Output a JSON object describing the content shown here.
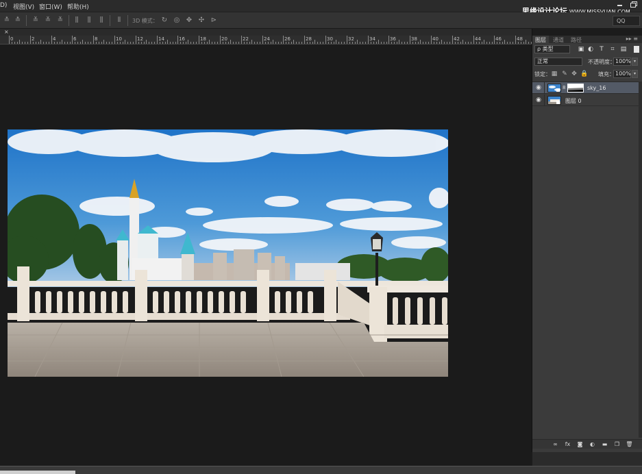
{
  "menubar": {
    "items": [
      "D)",
      "视图(V)",
      "窗口(W)",
      "帮助(H)"
    ]
  },
  "watermark": {
    "text": "思缘设计论坛",
    "url": "WWW.MISSVUAN.COM"
  },
  "optionsbar": {
    "mode_label": "3D 模式：",
    "qq_label": "QQ"
  },
  "ruler": {
    "labels": [
      "0",
      "2",
      "4",
      "6",
      "8",
      "10",
      "12",
      "14",
      "16",
      "18",
      "20",
      "22",
      "24",
      "26",
      "28",
      "30",
      "32",
      "34",
      "36",
      "38",
      "40",
      "42",
      "44",
      "46",
      "48"
    ]
  },
  "panel": {
    "tabs": [
      "图层",
      "通道",
      "路径"
    ],
    "filter_select": "ρ 类型",
    "blend_mode": "正常",
    "opacity_label": "不透明度：",
    "opacity_value": "100%",
    "lock_label": "锁定：",
    "fill_label": "填充：",
    "fill_value": "100%",
    "layers": [
      {
        "name": "sky_16",
        "selected": true,
        "has_mask": true
      },
      {
        "name": "图层 0",
        "selected": false,
        "has_mask": false
      }
    ]
  },
  "icons": {
    "menu": "panel-menu-icon",
    "visibility": "eye-icon",
    "footer": [
      "link-icon",
      "fx-icon",
      "mask-icon",
      "adjustment-icon",
      "folder-icon",
      "new-layer-icon",
      "trash-icon"
    ]
  }
}
